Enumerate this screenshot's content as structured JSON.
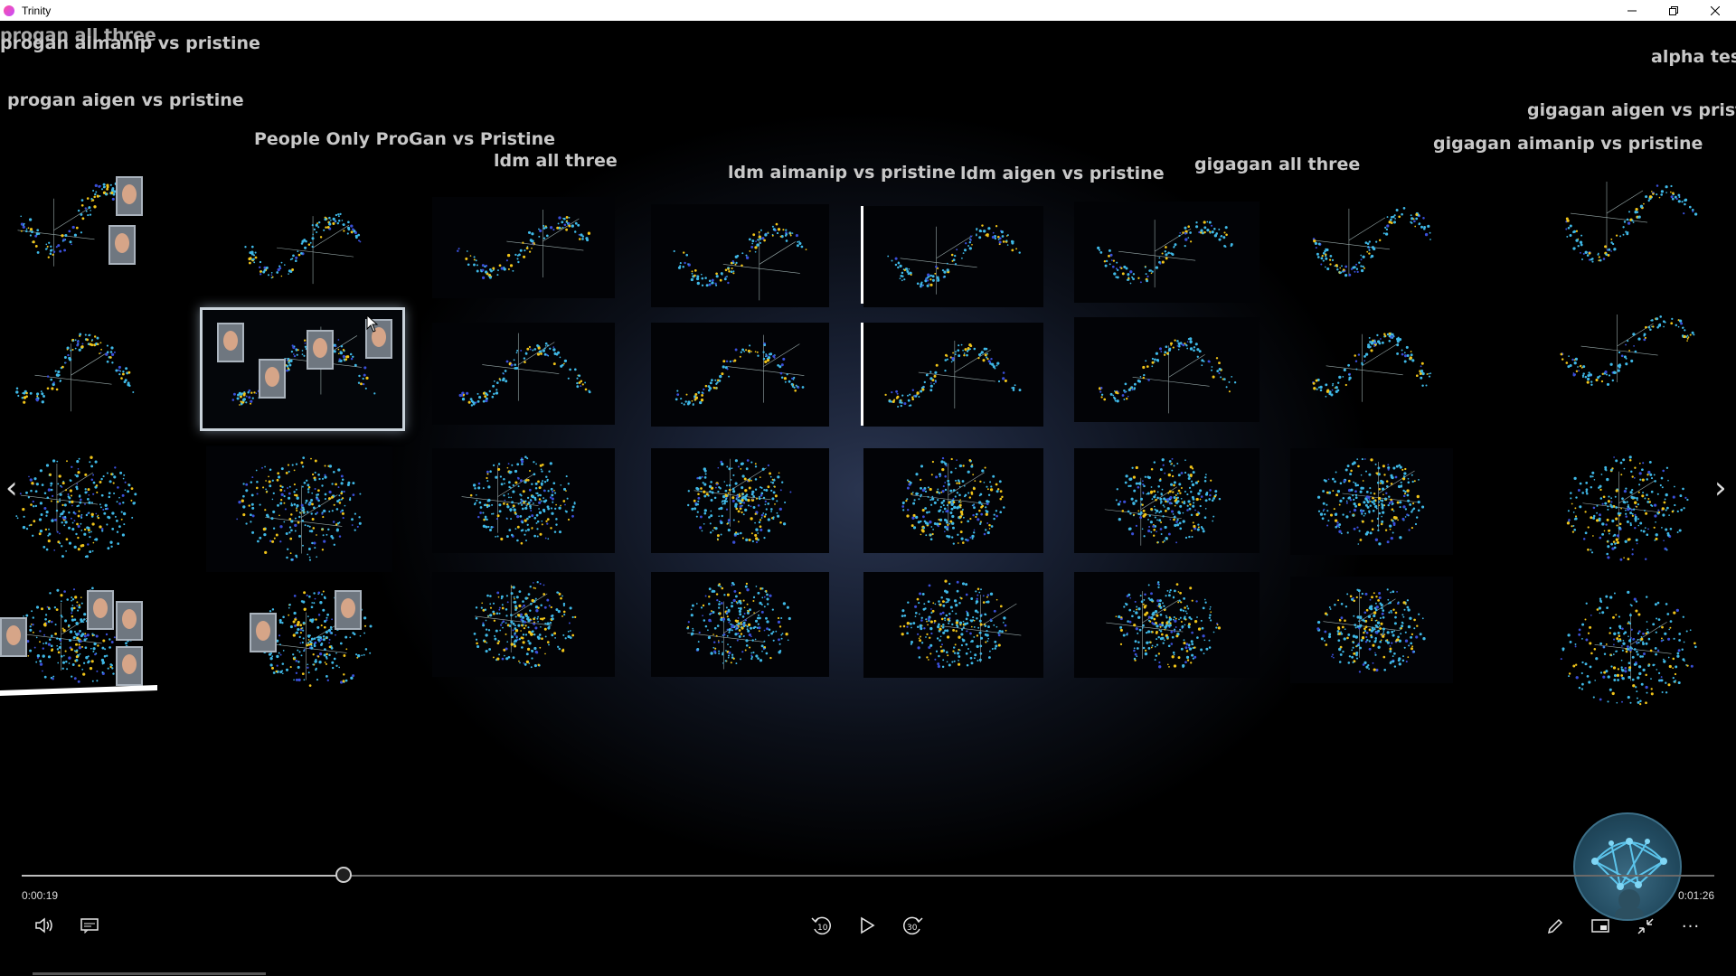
{
  "window": {
    "title": "Trinity",
    "minimize_icon": "minimize-icon",
    "restore_icon": "restore-icon",
    "close_icon": "close-icon"
  },
  "labels": {
    "progan_all_three": "progan all three",
    "progan_aimanip": "progan aimanip vs pristine",
    "progan_aigen": "progan aigen vs pristine",
    "people_only": "People Only ProGan vs Pristine",
    "ldm_all_three": "ldm all three",
    "ldm_aimanip": "ldm aimanip vs pristine",
    "ldm_aigen": "ldm aigen vs pristine",
    "gigagan_all_three": "gigagan all three",
    "gigagan_aimanip": "gigagan aimanip vs pristine",
    "gigagan_aigen": "gigagan aigen vs pristine",
    "alpha_test": "alpha test"
  },
  "player": {
    "elapsed": "0:00:19",
    "total": "0:01:26",
    "progress_fraction": 0.19,
    "icons": [
      "volume-icon",
      "captions-icon",
      "skip-back-10-icon",
      "play-icon",
      "skip-forward-30-icon",
      "pen-icon",
      "miniview-icon",
      "exit-fullscreen-icon",
      "more-icon"
    ],
    "skip_back_label": "10",
    "skip_forward_label": "30"
  },
  "colors": {
    "cyan": "#3fb8e6",
    "yellow": "#f0c419",
    "blue": "#3a4fd8",
    "selection": "#c9d2da"
  }
}
